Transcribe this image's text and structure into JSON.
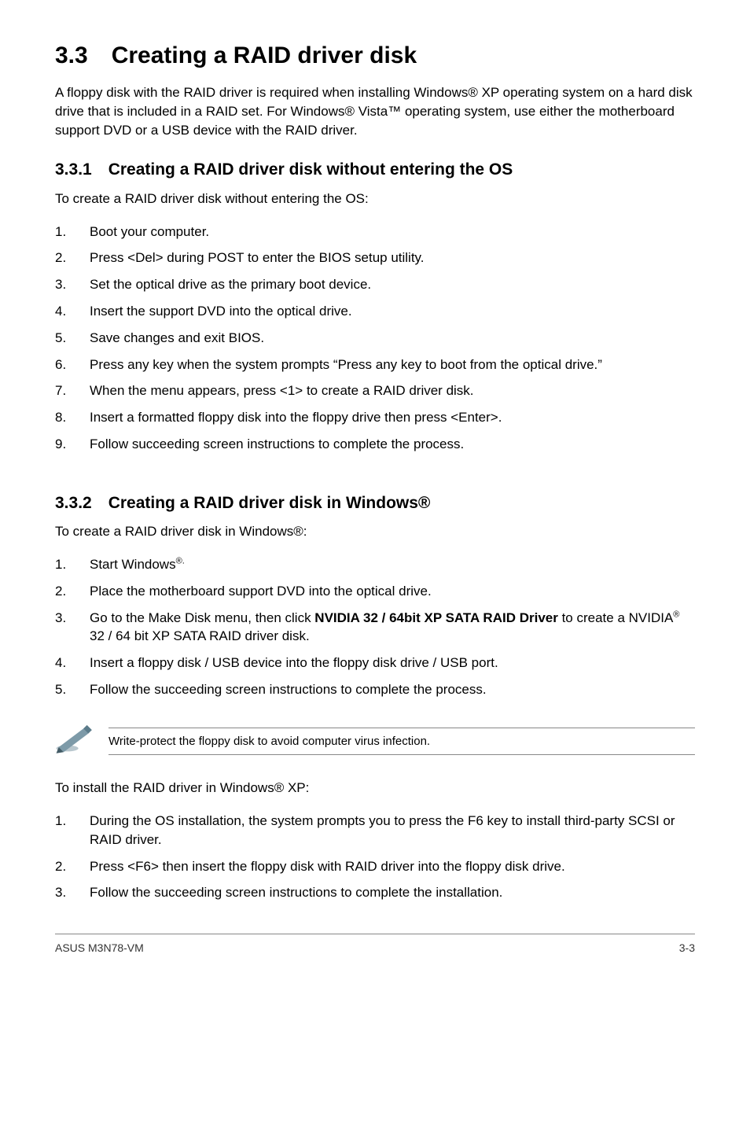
{
  "title": "3.3 Creating a RAID driver disk",
  "intro": "A floppy disk with the RAID driver is required when installing Windows® XP operating system on a hard disk drive that is included in a RAID set. For Windows® Vista™ operating system, use either the motherboard support DVD or a USB device with the RAID driver.",
  "s331": {
    "heading": "3.3.1 Creating a RAID driver disk without entering the OS",
    "lead": "To create a RAID driver disk without entering the OS:",
    "items": [
      "Boot your computer.",
      "Press <Del> during POST to enter the BIOS setup utility.",
      "Set the optical drive as the primary boot device.",
      "Insert the support DVD into the optical drive.",
      "Save changes and exit BIOS.",
      "Press any key when the system prompts “Press any key to boot from the optical drive.”",
      "When the menu appears, press <1> to create a RAID driver disk.",
      "Insert a formatted floppy disk into the floppy drive then press <Enter>.",
      "Follow succeeding screen instructions to complete the process."
    ]
  },
  "s332": {
    "heading": "3.3.2 Creating a RAID driver disk in Windows®",
    "lead": "To create a RAID driver disk in Windows®:",
    "items_html": [
      "Start Windows<sup>®.</sup>",
      "Place the motherboard support DVD into the optical drive.",
      "Go to the Make Disk menu, then click <b>NVIDIA 32 / 64bit XP SATA RAID Driver</b> to create a NVIDIA<sup>®</sup> 32 / 64 bit XP SATA RAID driver disk.",
      "Insert a floppy disk / USB device into the floppy disk drive / USB port.",
      "Follow the succeeding screen instructions to complete the process."
    ],
    "note": "Write-protect the floppy disk to avoid computer virus infection.",
    "install_lead": "To install the RAID driver in Windows® XP:",
    "install_items": [
      "During the OS installation, the system prompts you to press the F6 key to install third-party SCSI or RAID driver.",
      "Press <F6> then insert the floppy disk with RAID driver into the floppy disk drive.",
      "Follow the succeeding screen instructions to complete the installation."
    ]
  },
  "footer": {
    "left": "ASUS M3N78-VM",
    "right": "3-3"
  }
}
